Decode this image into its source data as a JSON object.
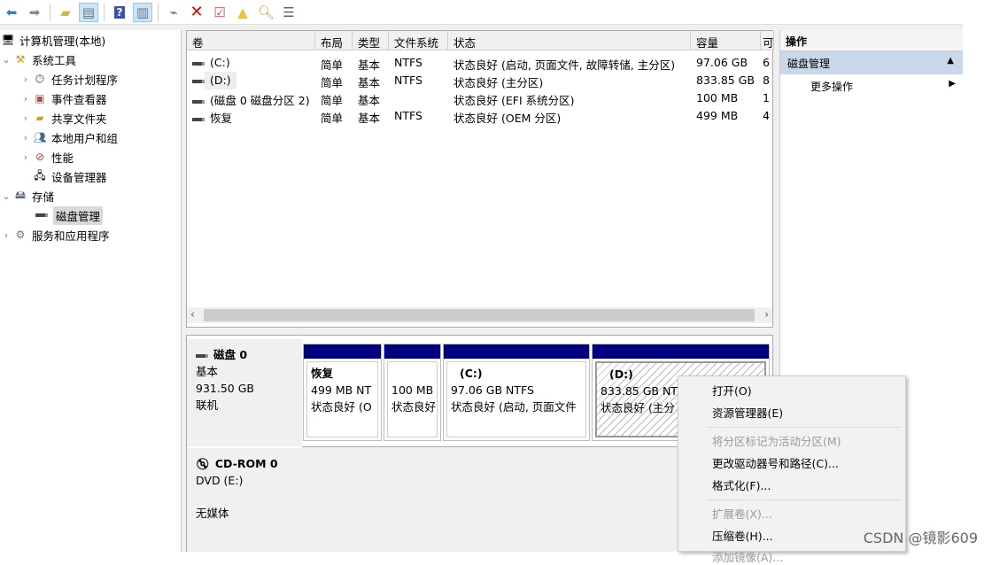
{
  "toolbar": {
    "icons": [
      "back-icon",
      "forward-icon",
      "up-folder-icon",
      "show-hide-tree-icon",
      "help-icon",
      "show-hide-action-icon",
      "connect-icon",
      "delete-icon",
      "properties-icon",
      "export-icon",
      "search-icon",
      "list-icon"
    ]
  },
  "tree": {
    "items": [
      {
        "label": "计算机管理(本地)",
        "icon": "computer-management-icon"
      },
      {
        "label": "系统工具",
        "icon": "tools-icon"
      },
      {
        "label": "任务计划程序",
        "icon": "clock-icon"
      },
      {
        "label": "事件查看器",
        "icon": "event-viewer-icon"
      },
      {
        "label": "共享文件夹",
        "icon": "shared-folder-icon"
      },
      {
        "label": "本地用户和组",
        "icon": "users-icon"
      },
      {
        "label": "性能",
        "icon": "performance-icon"
      },
      {
        "label": "设备管理器",
        "icon": "device-manager-icon"
      },
      {
        "label": "存储",
        "icon": "storage-icon"
      },
      {
        "label": "磁盘管理",
        "icon": "disk-icon"
      },
      {
        "label": "服务和应用程序",
        "icon": "services-icon"
      }
    ]
  },
  "table": {
    "headers": [
      "卷",
      "布局",
      "类型",
      "文件系统",
      "状态",
      "容量",
      "可"
    ],
    "rows": [
      [
        "(C:)",
        "简单",
        "基本",
        "NTFS",
        "状态良好 (启动, 页面文件, 故障转储, 主分区)",
        "97.06 GB",
        "6"
      ],
      [
        "(D:)",
        "简单",
        "基本",
        "NTFS",
        "状态良好 (主分区)",
        "833.85 GB",
        "8"
      ],
      [
        "(磁盘 0 磁盘分区 2)",
        "简单",
        "基本",
        "",
        "状态良好 (EFI 系统分区)",
        "100 MB",
        "1"
      ],
      [
        "恢复",
        "简单",
        "基本",
        "NTFS",
        "状态良好 (OEM 分区)",
        "499 MB",
        "4"
      ]
    ]
  },
  "disks": [
    {
      "name": "磁盘 0",
      "type": "基本",
      "size": "931.50 GB",
      "status": "联机",
      "partitions": [
        {
          "name": "恢复",
          "size": "499 MB NT",
          "status": "状态良好 (O"
        },
        {
          "name": "",
          "size": "100 MB",
          "status": "状态良好"
        },
        {
          "name": "(C:)",
          "size": "97.06 GB NTFS",
          "status": "状态良好 (启动, 页面文件"
        },
        {
          "name": "(D:)",
          "size": "833.85 GB NT",
          "status": "状态良好 (主分"
        }
      ]
    },
    {
      "name": "CD-ROM 0",
      "type": "DVD (E:)",
      "status": "无媒体"
    }
  ],
  "actions": {
    "title": "操作",
    "section": "磁盘管理",
    "more": "更多操作"
  },
  "context_menu": {
    "items": [
      {
        "label": "打开(O)",
        "enabled": true
      },
      {
        "label": "资源管理器(E)",
        "enabled": true
      },
      {
        "label": "将分区标记为活动分区(M)",
        "enabled": false
      },
      {
        "label": "更改驱动器号和路径(C)...",
        "enabled": true
      },
      {
        "label": "格式化(F)...",
        "enabled": true
      },
      {
        "label": "扩展卷(X)...",
        "enabled": false
      },
      {
        "label": "压缩卷(H)...",
        "enabled": true
      },
      {
        "label": "添加镜像(A)...",
        "enabled": false
      }
    ]
  },
  "watermark": "CSDN @镜影609"
}
